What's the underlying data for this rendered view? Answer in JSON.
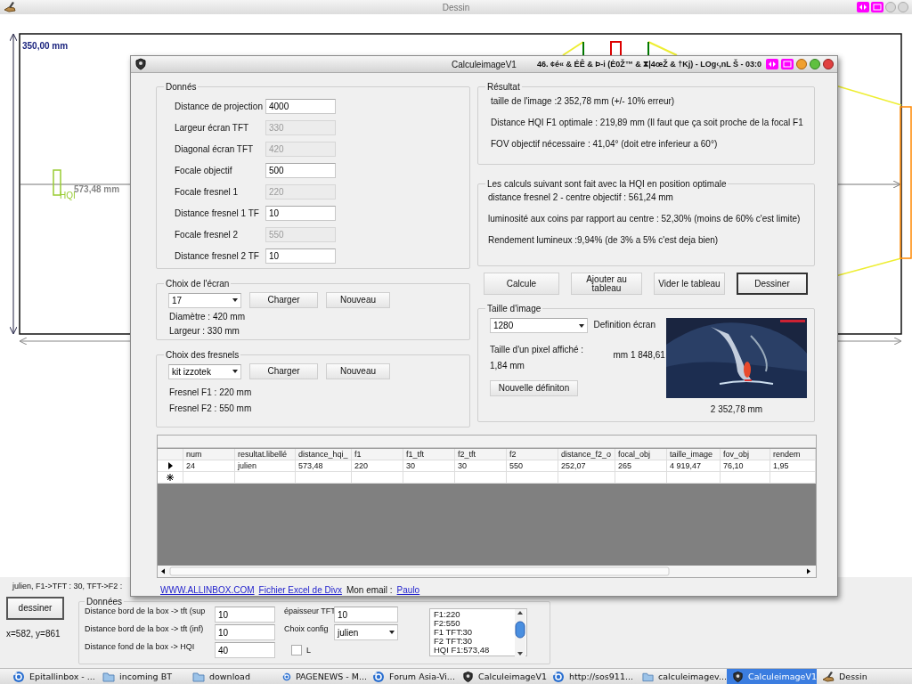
{
  "dessin": {
    "title": "Dessin",
    "drawing": {
      "height_label": "350,00 mm",
      "lamp_label": "HQI",
      "distance_label": "573,48 mm"
    },
    "status_text": "julien, F1->TFT : 30, TFT->F2 :",
    "draw_button": "dessiner",
    "coordinates": "x=582, y=861",
    "settings": {
      "title": "Données",
      "fields": [
        {
          "label": "Distance bord de la box -> tft (sup",
          "value": "10"
        },
        {
          "label": "Distance bord de la box -> tft (inf)",
          "value": "10"
        },
        {
          "label": "Distance fond de la box -> HQI",
          "value": "40"
        }
      ],
      "thickness": {
        "label": "épaisseur TFT",
        "value": "10"
      },
      "config": {
        "label": "Choix config",
        "value": "julien"
      },
      "option": {
        "label": "L",
        "checked": false
      }
    },
    "summary_list": [
      "F1:220",
      "F2:550",
      "F1 TFT:30",
      "F2 TFT:30",
      "HQI F1:573,48"
    ]
  },
  "dialog": {
    "title": "CalculeimageV1",
    "title_extra": "46. ¢é« & ÉÊ & Þ-i (Ė0Ž™ & ⧗|4œŽ & †Kj) - LOg‹,nL Š - 03:0",
    "inputs": {
      "title": "Donnés",
      "fields": [
        {
          "label": "Distance de projection",
          "value": "4000",
          "disabled": false
        },
        {
          "label": "Largeur écran TFT",
          "value": "330",
          "disabled": true
        },
        {
          "label": "Diagonal écran TFT",
          "value": "420",
          "disabled": true
        },
        {
          "label": "Focale objectif",
          "value": "500",
          "disabled": false
        },
        {
          "label": "Focale fresnel 1",
          "value": "220",
          "disabled": true
        },
        {
          "label": "Distance fresnel 1 TF",
          "value": "10",
          "disabled": false
        },
        {
          "label": "Focale fresnel 2",
          "value": "550",
          "disabled": true
        },
        {
          "label": "Distance fresnel 2 TF",
          "value": "10",
          "disabled": false
        }
      ]
    },
    "screen": {
      "title": "Choix de l'écran",
      "value": "17",
      "buttons": [
        "Charger",
        "Nouveau"
      ],
      "lines": [
        "Diamètre : 420 mm",
        "Largeur : 330 mm"
      ]
    },
    "fresnels": {
      "title": "Choix des fresnels",
      "value": "kit izzotek",
      "buttons": [
        "Charger",
        "Nouveau"
      ],
      "lines": [
        "Fresnel F1 : 220 mm",
        "Fresnel F2 : 550 mm"
      ]
    },
    "result": {
      "title": "Résultat",
      "lines": [
        "taille de l'image :2 352,78 mm (+/- 10% erreur)",
        "Distance HQI F1 optimale : 219,89 mm (Il faut que ça soit proche de la focal F1",
        "FOV objectif nécessaire : 41,04° (doit etre inferieur a 60°)"
      ]
    },
    "optimal": {
      "title": "Les calculs suivant sont fait avec la HQI en position optimale",
      "lines": [
        "distance fresnel 2 - centre objectif : 561,24 mm",
        "luminosité aux coins par rapport au centre : 52,30% (moins de 60% c'est limite)",
        "Rendement lumineux :9,94% (de 3% a 5% c'est deja bien)"
      ]
    },
    "actions": [
      {
        "label": "Calcule",
        "default": false
      },
      {
        "label": "Ajouter au tableau",
        "default": false
      },
      {
        "label": "Vider le tableau",
        "default": false
      },
      {
        "label": "Dessiner",
        "default": true
      }
    ],
    "image_size": {
      "title": "Taille d'image",
      "value": "1280",
      "definition_label": "Definition écran",
      "pixel_label": "Taille d'un pixel affiché :",
      "pixel_value": "1,84 mm",
      "width_value": "mm 1 848,61",
      "button": "Nouvelle définiton",
      "caption": "2 352,78 mm"
    },
    "table": {
      "columns": [
        "num",
        "resultat.libellé",
        "distance_hqi_",
        "f1",
        "f1_tft",
        "f2_tft",
        "f2",
        "distance_f2_o",
        "focal_obj",
        "taille_image",
        "fov_obj",
        "rendem"
      ],
      "rows": [
        {
          "current": true,
          "cells": [
            "24",
            "julien",
            "573,48",
            "220",
            "30",
            "30",
            "550",
            "252,07",
            "265",
            "4 919,47",
            "76,10",
            "1,95"
          ]
        }
      ]
    },
    "links": [
      {
        "kind": "link",
        "text": "WWW.ALLINBOX.COM"
      },
      {
        "kind": "link",
        "text": "Fichier Excel de Divx"
      },
      {
        "kind": "text",
        "text": "Mon email :"
      },
      {
        "kind": "link",
        "text": "Paulo"
      }
    ]
  },
  "taskbar": [
    {
      "label": "Epitallinbox - ...",
      "kind": "browser",
      "selected": false
    },
    {
      "label": "incoming BT",
      "kind": "folder",
      "selected": false
    },
    {
      "label": "download",
      "kind": "folder",
      "selected": false
    },
    {
      "label": "PAGENEWS - M...",
      "kind": "browser",
      "selected": false
    },
    {
      "label": "Forum Asia-Vi...",
      "kind": "browser",
      "selected": false
    },
    {
      "label": "CalculeimageV1",
      "kind": "app",
      "selected": false
    },
    {
      "label": "http://sos911...",
      "kind": "browser",
      "selected": false
    },
    {
      "label": "calculeimagev...",
      "kind": "folder",
      "selected": false
    },
    {
      "label": "CalculeimageV1",
      "kind": "app",
      "selected": true
    },
    {
      "label": "Dessin",
      "kind": "paint",
      "selected": false
    }
  ]
}
